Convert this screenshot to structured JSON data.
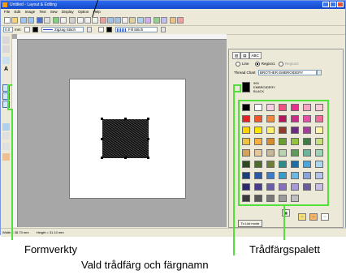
{
  "window": {
    "title": "Untitled - Layout & Editing",
    "menu": [
      "File",
      "Edit",
      "Image",
      "Text",
      "Sew",
      "Display",
      "Option",
      "Help"
    ]
  },
  "toolbar2": {
    "size_value": "0.0",
    "size_unit": "mm",
    "line_sew_type": "Zigzag Stitch",
    "region_sew_type": "Fill Stitch"
  },
  "status": {
    "width": "Width = 38.70 mm",
    "height": "Height = 31.10 mm"
  },
  "panel": {
    "tab_label": "ABC",
    "radio_line": "Line",
    "radio_region1": "Region1",
    "radio_region2": "Region2",
    "thread_chart_label": "Thread Chart",
    "thread_chart_value": "BROTHER EMBROIDERY",
    "thread_number": "900",
    "thread_type": "EMBROIDERY",
    "thread_name": "BLACK",
    "to_list_mode": "To List mode"
  },
  "palette": {
    "colors": [
      "#000000",
      "#ffffff",
      "#f7d1e1",
      "#f0507e",
      "#e8308d",
      "#f6a3c4",
      "#f7c8d6",
      "#e32222",
      "#f0572b",
      "#f08a3a",
      "#b5175b",
      "#c62c88",
      "#e44fa8",
      "#f06a9a",
      "#ffd400",
      "#ffe400",
      "#fff06a",
      "#8e3c2b",
      "#6c2b7f",
      "#a43e99",
      "#fff7a8",
      "#f0c040",
      "#f6b040",
      "#d48c2e",
      "#6a9e2e",
      "#95c23d",
      "#3f7c44",
      "#c5df7e",
      "#d6a25a",
      "#e6c79a",
      "#c6b897",
      "#b8d3b0",
      "#5c9b58",
      "#6bb49b",
      "#9bd3b5",
      "#2f4a20",
      "#4f6b2d",
      "#6f7f3a",
      "#2e8c8c",
      "#1e6ea6",
      "#4aa6d8",
      "#a9d7f0",
      "#1c3f7a",
      "#2c58a8",
      "#3c7cc8",
      "#3a9cc8",
      "#6bb8e0",
      "#8aa3d8",
      "#b0c4ea",
      "#2a2a6c",
      "#4a3c8c",
      "#6a5ca8",
      "#8a6fc0",
      "#a89ad6",
      "#6c5b99",
      "#c8bde6",
      "#3a3a3a",
      "#585858",
      "#7a7a7a",
      "#9c9c9c",
      "#bfbfbf"
    ]
  },
  "callouts": {
    "shape_tools": "Formverkty",
    "thread_palette": "Trådfärgspalett",
    "selected_color": "Vald trådfärg och färgnamn"
  }
}
